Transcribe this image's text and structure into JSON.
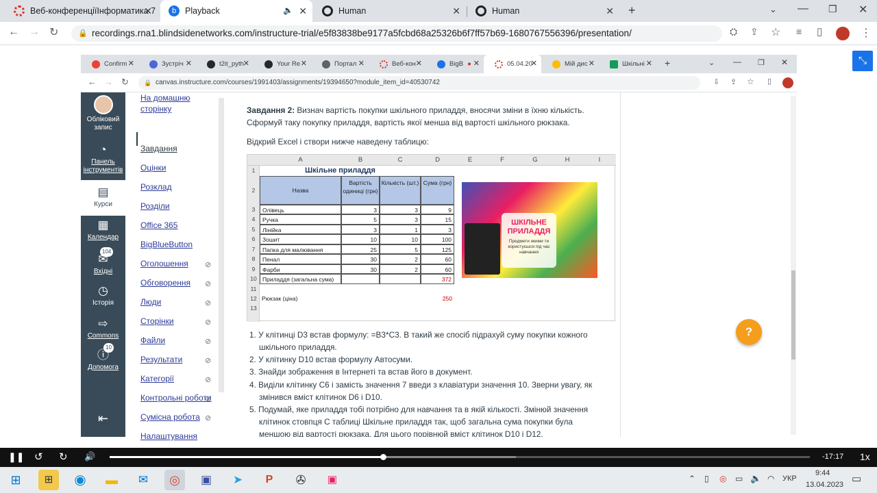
{
  "browser": {
    "tabs": [
      {
        "title": "Веб-конференціїІнформатика 7",
        "color": "#d93025"
      },
      {
        "title": "Playback",
        "color": "#1a73e8"
      },
      {
        "title": "Human",
        "color": "#202124"
      },
      {
        "title": "Human",
        "color": "#202124"
      }
    ],
    "url": "recordings.rna1.blindsidenetworks.com/instructure-trial/e5f83838be9177a5fcbd68a25326b6f7ff57b69-1680767556396/presentation/"
  },
  "inner_browser": {
    "tabs": [
      "Confirm",
      "Зустріч",
      "t2it_pyth",
      "Your Re",
      "Портал",
      "Веб-кон",
      "BigB",
      "05.04.20",
      "Мій дис",
      "Шкільні"
    ],
    "url": "canvas.instructure.com/courses/1991403/assignments/19394650?module_item_id=40530742"
  },
  "global_nav": [
    {
      "label": "Обліковий запис",
      "icon": "avatar"
    },
    {
      "label": "Панель інструментів",
      "icon": "dashboard-icon"
    },
    {
      "label": "Курси",
      "icon": "courses-icon"
    },
    {
      "label": "Календар",
      "icon": "calendar-icon"
    },
    {
      "label": "Вхідні",
      "icon": "inbox-icon",
      "badge": "104"
    },
    {
      "label": "Історія",
      "icon": "history-icon"
    },
    {
      "label": "Commons",
      "icon": "commons-icon"
    },
    {
      "label": "Допомога",
      "icon": "help-icon",
      "badge": "10"
    }
  ],
  "course_nav": [
    {
      "label": "На домашню сторінку",
      "hidden": false
    },
    {
      "label": "Завдання",
      "hidden": false,
      "active": true
    },
    {
      "label": "Оцінки",
      "hidden": false
    },
    {
      "label": "Розклад",
      "hidden": false
    },
    {
      "label": "Розділи",
      "hidden": false
    },
    {
      "label": "Office 365",
      "hidden": false
    },
    {
      "label": "BigBlueButton",
      "hidden": false
    },
    {
      "label": "Оголошення",
      "hidden": true
    },
    {
      "label": "Обговорення",
      "hidden": true
    },
    {
      "label": "Люди",
      "hidden": true
    },
    {
      "label": "Сторінки",
      "hidden": true
    },
    {
      "label": "Файли",
      "hidden": true
    },
    {
      "label": "Результати",
      "hidden": true
    },
    {
      "label": "Категорії",
      "hidden": true
    },
    {
      "label": "Контрольні роботи",
      "hidden": true
    },
    {
      "label": "Сумісна робота",
      "hidden": true
    },
    {
      "label": "Налаштування",
      "hidden": false
    }
  ],
  "content": {
    "task_title": "Завдання 2:",
    "task_text1": " Визнач вартість покупки шкільного приладдя, вносячи зміни в їхню кількість.",
    "task_text2": "Сформуй таку покупку приладдя, вартість якої менша від вартості шкільного рюкзака.",
    "open_excel": "Відкрий Excel і створи нижче наведену таблицю:",
    "sheet": {
      "columns": [
        "A",
        "B",
        "C",
        "D",
        "E",
        "F",
        "G",
        "H",
        "I"
      ],
      "title": "Шкільне приладдя",
      "headers": [
        "Назва",
        "Вартість одиниці (грн)",
        "Кількість (шт.)",
        "Сума (грн)"
      ],
      "rows": [
        [
          "Олівець",
          "3",
          "3",
          "9"
        ],
        [
          "Ручка",
          "5",
          "3",
          "15"
        ],
        [
          "Лінійка",
          "3",
          "1",
          "3"
        ],
        [
          "Зошит",
          "10",
          "10",
          "100"
        ],
        [
          "Папка для малювання",
          "25",
          "5",
          "125"
        ],
        [
          "Пенал",
          "30",
          "2",
          "60"
        ],
        [
          "Фарби",
          "30",
          "2",
          "60"
        ]
      ],
      "total_label": "Приладдя (загальна сума)",
      "total_value": "372",
      "backpack_label": "Рюкзак (ціна)",
      "backpack_value": "250",
      "image_title": "ШКІЛЬНЕ ПРИЛАДДЯ",
      "image_subtitle": "Предмети якими ти користуєшся під час навчання"
    },
    "steps": [
      [
        "У клітинці D3 встав формулу: =B3*C3. В такий же спосіб підрахуй суму покупки кожного",
        "шкільного приладдя."
      ],
      [
        "У клітинку D10 встав формулу Автосуми."
      ],
      [
        "Знайди зображення в Інтернеті та встав його в документ."
      ],
      [
        "Виділи клітинку C6 і замість значення 7 введи з клавіатури значення 10. Зверни увагу, як",
        "змінився вміст клітинок D6 і D10."
      ],
      [
        "Подумай, яке приладдя тобі потрібно для навчання та в якій кількості. Змінюй значення",
        "клітинок стовпця C таблиці Шкільне приладдя так, щоб загальна сума покупки була",
        "меншою від вартості рюкзака. Для цього порівнюй вміст клітинок D10 і D12."
      ]
    ]
  },
  "player": {
    "time_remaining": "-17:17",
    "speed": "1x",
    "progress": 0.39
  },
  "taskbar": {
    "lang": "УКР",
    "time": "9:44",
    "date": "13.04.2023"
  },
  "colors": {
    "canvas_nav": "#394b58",
    "link": "#2d3b97",
    "help": "#f59d1d"
  }
}
